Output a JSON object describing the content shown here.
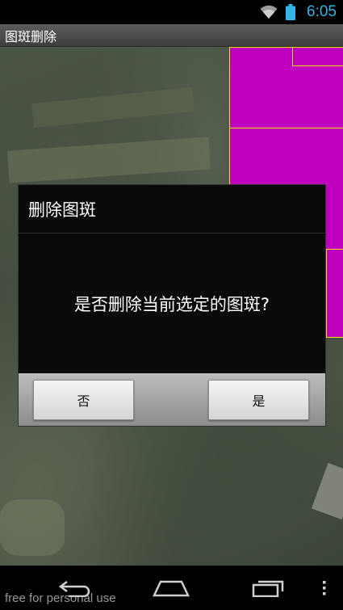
{
  "status_bar": {
    "time": "6:05",
    "icons": [
      "wifi-icon",
      "battery-icon"
    ],
    "accent_color": "#33b5e5"
  },
  "app": {
    "title": "图斑删除"
  },
  "map": {
    "parcel_fill_color": "#bf00bf",
    "parcel_border_color": "#e6e600"
  },
  "dialog": {
    "title": "删除图斑",
    "message": "是否删除当前选定的图斑?",
    "buttons": {
      "no_label": "否",
      "yes_label": "是"
    }
  },
  "nav_bar": {
    "icons": [
      "back-icon",
      "home-icon",
      "recent-apps-icon",
      "overflow-menu-icon"
    ]
  },
  "watermark": "free for personal use"
}
